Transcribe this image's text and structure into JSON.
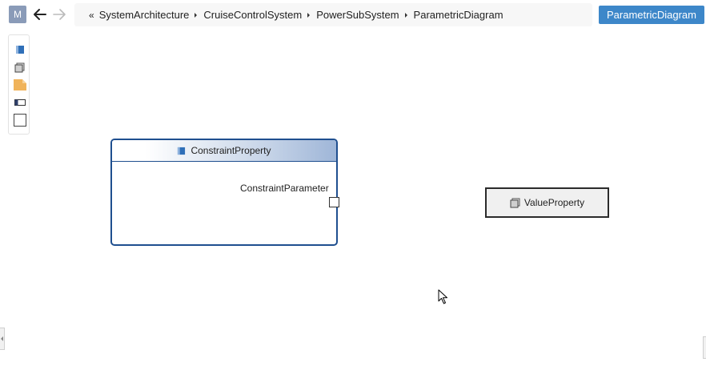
{
  "toolbar": {
    "model_badge": "M",
    "back_icon": "arrow-left-icon",
    "forward_icon": "arrow-right-icon",
    "diagram_button_label": "ParametricDiagram"
  },
  "breadcrumb": {
    "lead": "«",
    "items": [
      "SystemArchitecture",
      "CruiseControlSystem",
      "PowerSubSystem",
      "ParametricDiagram"
    ]
  },
  "palette": {
    "items": [
      {
        "icon": "constraint-block-icon"
      },
      {
        "icon": "value-property-icon"
      },
      {
        "icon": "note-icon"
      },
      {
        "icon": "constraint-parameter-icon"
      },
      {
        "icon": "rectangle-icon"
      }
    ]
  },
  "diagram": {
    "constraint_property": {
      "name": "ConstraintProperty",
      "parameter": "ConstraintParameter"
    },
    "value_property": {
      "name": "ValueProperty"
    }
  },
  "colors": {
    "accent": "#3d87c9",
    "block_border": "#1f4f8f",
    "badge": "#8a9bb8",
    "note": "#f0b35a"
  }
}
